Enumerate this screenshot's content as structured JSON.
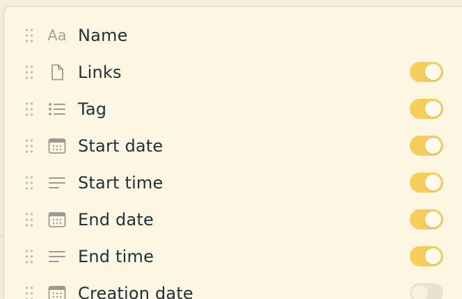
{
  "properties": [
    {
      "label": "Name",
      "icon": "text-type-icon",
      "visible": null
    },
    {
      "label": "Links",
      "icon": "file-icon",
      "visible": true
    },
    {
      "label": "Tag",
      "icon": "list-icon",
      "visible": true
    },
    {
      "label": "Start date",
      "icon": "calendar-icon",
      "visible": true
    },
    {
      "label": "Start time",
      "icon": "text-lines-icon",
      "visible": true
    },
    {
      "label": "End date",
      "icon": "calendar-icon",
      "visible": true
    },
    {
      "label": "End time",
      "icon": "text-lines-icon",
      "visible": true
    },
    {
      "label": "Creation date",
      "icon": "calendar-icon",
      "visible": false
    }
  ],
  "colors": {
    "toggle_on": "#f6cd59",
    "text": "#1c3139",
    "icon": "#9b9a92",
    "panel": "#fcf6e2"
  }
}
